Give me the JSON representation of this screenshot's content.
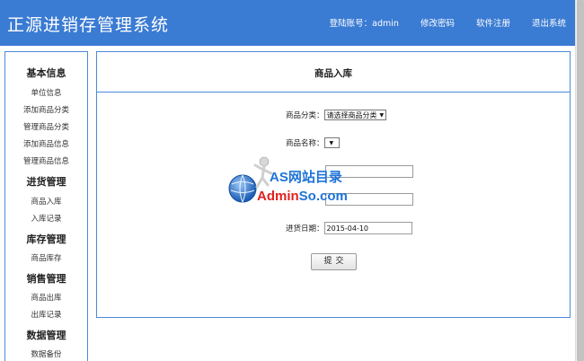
{
  "header": {
    "title": "正源进销存管理系统",
    "account": "登陆账号：admin",
    "change_password": "修改密码",
    "register": "软件注册",
    "logout": "退出系统"
  },
  "sidebar": {
    "groups": [
      {
        "heading": "基本信息",
        "items": [
          "单位信息",
          "添加商品分类",
          "管理商品分类",
          "添加商品信息",
          "管理商品信息"
        ]
      },
      {
        "heading": "进货管理",
        "items": [
          "商品入库",
          "入库记录"
        ]
      },
      {
        "heading": "库存管理",
        "items": [
          "商品库存"
        ]
      },
      {
        "heading": "销售管理",
        "items": [
          "商品出库",
          "出库记录"
        ]
      },
      {
        "heading": "数据管理",
        "items": [
          "数据备份"
        ]
      }
    ]
  },
  "main": {
    "title": "商品入库",
    "category_label": "商品分类：",
    "category_value": "请选择商品分类",
    "name_label": "商品名称：",
    "name_value": "",
    "quantity_value": "",
    "price_value": "",
    "date_label": "进货日期：",
    "date_value": "2015-04-10",
    "submit_label": "提交"
  },
  "watermark": {
    "line1": "AS网站目录",
    "line2_red": "Admin",
    "line2_blue": "So.com"
  },
  "colors": {
    "header_bg": "#3a7bd3",
    "border_blue": "#4a8ad8",
    "watermark_blue": "#1e73d8",
    "watermark_red": "#e02020"
  }
}
